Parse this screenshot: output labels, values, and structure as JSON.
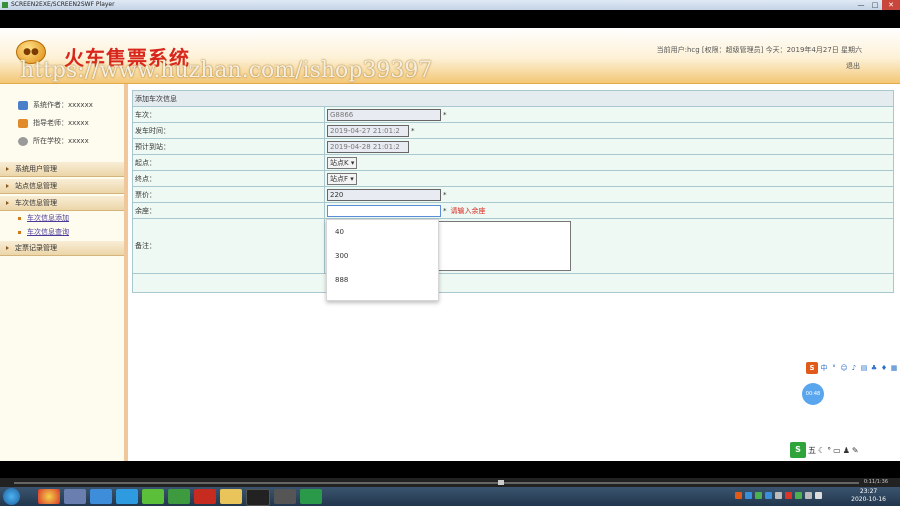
{
  "window": {
    "title": "SCREEN2EXE/SCREEN2SWF Player",
    "minimize": "—",
    "maximize": "□",
    "close": "✕"
  },
  "header": {
    "system_title": "火车售票系统",
    "watermark": "https://www.huzhan.com/ishop39397",
    "user_info": "当前用户:hcg [权限：超级管理员] 今天：2019年4月27日 星期六",
    "logout": "退出"
  },
  "sidebar": {
    "info": [
      {
        "icon": "user-icon",
        "text": "系统作者：xxxxxx"
      },
      {
        "icon": "teacher-icon",
        "text": "指导老师：xxxxx"
      },
      {
        "icon": "school-icon",
        "text": "所在学校：xxxxx"
      }
    ],
    "menus": [
      {
        "label": "系统用户管理",
        "items": []
      },
      {
        "label": "站点信息管理",
        "items": []
      },
      {
        "label": "车次信息管理",
        "items": [
          "车次信息添加",
          "车次信息查询"
        ]
      },
      {
        "label": "定票记录管理",
        "items": []
      }
    ]
  },
  "form": {
    "title": "添加车次信息",
    "rows": [
      {
        "label": "车次：",
        "value": "G8866",
        "required": "*"
      },
      {
        "label": "发车时间：",
        "value": "2019-04-27 21:01:2",
        "required": "*"
      },
      {
        "label": "预计到站：",
        "value": "2019-04-28 21:01:2",
        "required": ""
      },
      {
        "label": "起点：",
        "value": "站点K",
        "required": ""
      },
      {
        "label": "终点：",
        "value": "站点F",
        "required": ""
      },
      {
        "label": "票价：",
        "value": "220",
        "required": "*"
      },
      {
        "label": "余座：",
        "value": "",
        "required": "*",
        "error": "请输入余座"
      },
      {
        "label": "备注：",
        "value": "",
        "required": ""
      }
    ]
  },
  "dropdown": {
    "options": [
      "40",
      "300",
      "888"
    ]
  },
  "ime": {
    "logo": "S",
    "bubble": "00:48",
    "logo2": "S",
    "mode": "五"
  },
  "player": {
    "time": "0:11/1:36"
  },
  "taskbar": {
    "time": "23:27",
    "date": "2020-10-16"
  },
  "colors": {
    "accent": "#d9261c",
    "header_bottom": "#f3c777",
    "form_bg": "#eef9f3",
    "border": "#a9c7cf"
  }
}
